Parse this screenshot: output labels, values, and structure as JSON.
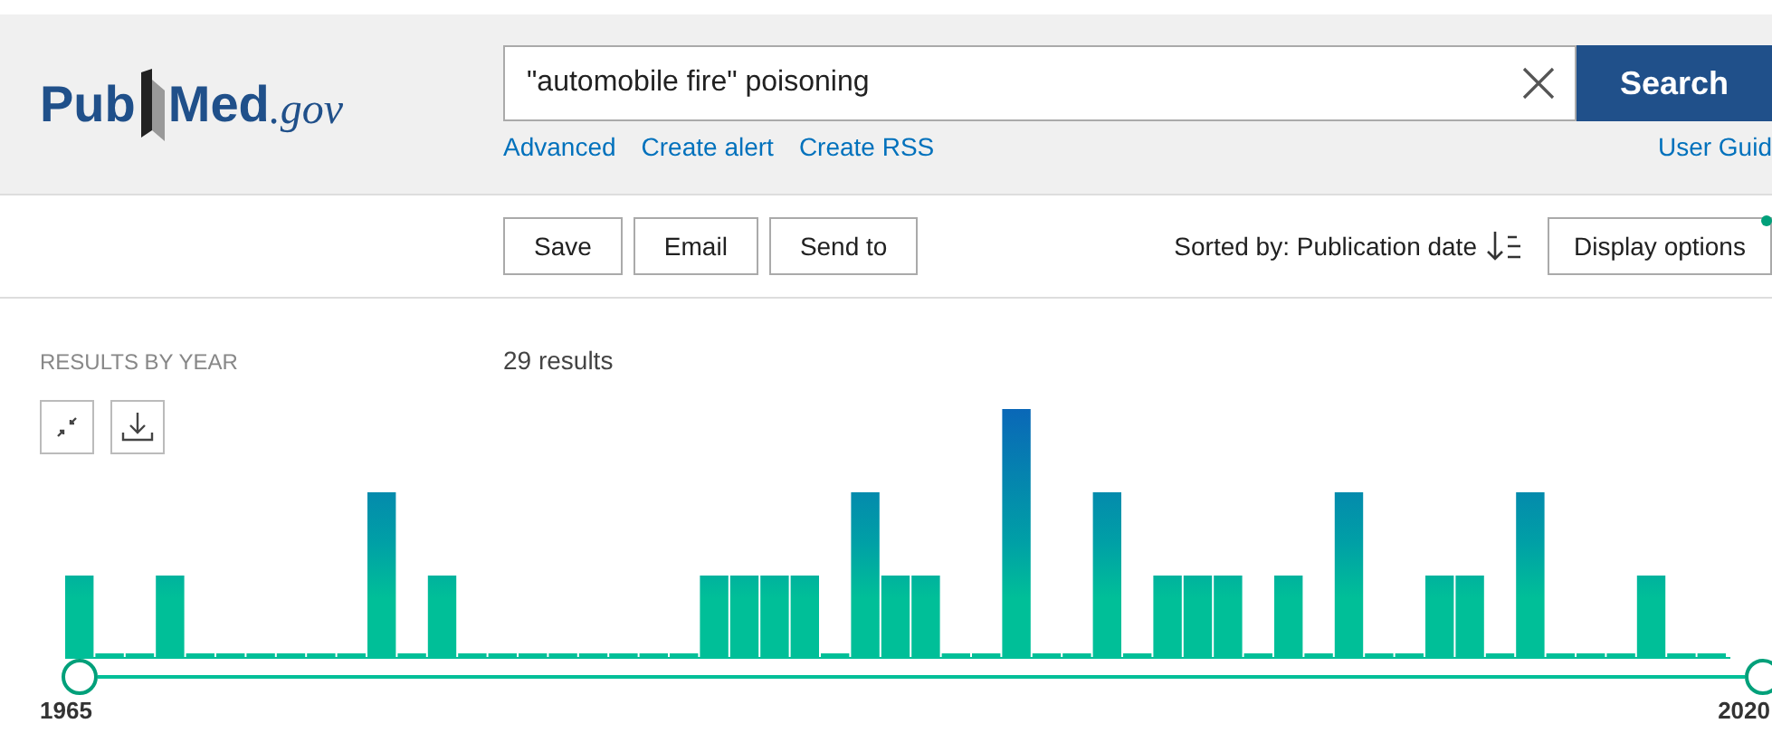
{
  "header": {
    "logo": {
      "pub": "Pub",
      "med": "Med",
      "suffix": ".gov"
    },
    "search": {
      "value": "\"automobile fire\" poisoning",
      "button": "Search"
    },
    "links": [
      "Advanced",
      "Create alert",
      "Create RSS"
    ],
    "user_guide": "User Guid"
  },
  "toolbar": {
    "actions": [
      "Save",
      "Email",
      "Send to"
    ],
    "sort_label": "Sorted by: Publication date",
    "display_options": "Display options",
    "display_options_modified": true
  },
  "results_by_year": {
    "title": "RESULTS BY YEAR",
    "count": "29 results",
    "range_start": "1965",
    "range_end": "2020"
  }
}
